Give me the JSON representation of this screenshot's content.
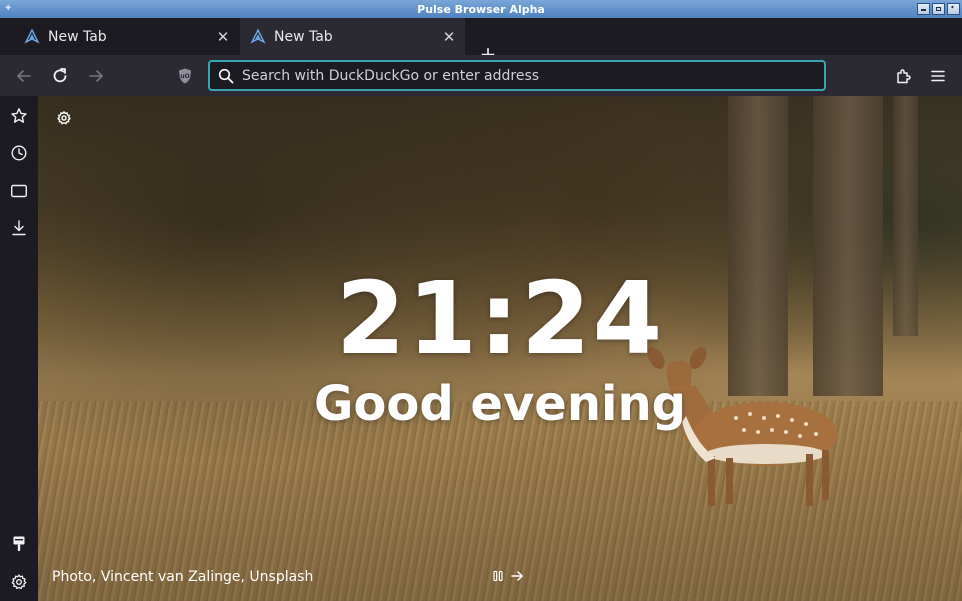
{
  "window": {
    "title": "Pulse Browser Alpha"
  },
  "tabs": [
    {
      "label": "New Tab",
      "active": false
    },
    {
      "label": "New Tab",
      "active": true
    }
  ],
  "urlbar": {
    "placeholder": "Search with DuckDuckGo or enter address",
    "value": ""
  },
  "content": {
    "clock": "21:24",
    "greeting": "Good evening",
    "photo_credit": "Photo, Vincent van Zalinge, Unsplash"
  },
  "colors": {
    "accent": "#3aa5b2",
    "toolbar": "#2b2a33",
    "chrome": "#1c1b22",
    "titlebar": "#5a8cc8"
  },
  "icons": {
    "sidebar": [
      "star-icon",
      "history-icon",
      "tab-icon",
      "download-icon",
      "brush-icon",
      "gear-icon"
    ],
    "nav": [
      "back-icon",
      "reload-icon",
      "forward-icon",
      "shield-icon",
      "extensions-icon",
      "menu-icon"
    ]
  }
}
